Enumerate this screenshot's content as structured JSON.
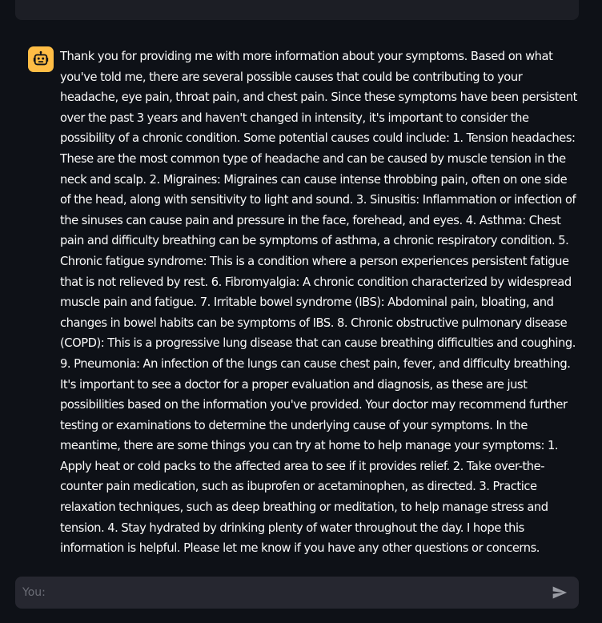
{
  "assistant_message": {
    "text": "Thank you for providing me with more information about your symptoms. Based on what you've told me, there are several possible causes that could be contributing to your headache, eye pain, throat pain, and chest pain. Since these symptoms have been persistent over the past 3 years and haven't changed in intensity, it's important to consider the possibility of a chronic condition. Some potential causes could include: 1. Tension headaches: These are the most common type of headache and can be caused by muscle tension in the neck and scalp. 2. Migraines: Migraines can cause intense throbbing pain, often on one side of the head, along with sensitivity to light and sound. 3. Sinusitis: Inflammation or infection of the sinuses can cause pain and pressure in the face, forehead, and eyes. 4. Asthma: Chest pain and difficulty breathing can be symptoms of asthma, a chronic respiratory condition. 5. Chronic fatigue syndrome: This is a condition where a person experiences persistent fatigue that is not relieved by rest. 6. Fibromyalgia: A chronic condition characterized by widespread muscle pain and fatigue. 7. Irritable bowel syndrome (IBS): Abdominal pain, bloating, and changes in bowel habits can be symptoms of IBS. 8. Chronic obstructive pulmonary disease (COPD): This is a progressive lung disease that can cause breathing difficulties and coughing. 9. Pneumonia: An infection of the lungs can cause chest pain, fever, and difficulty breathing. It's important to see a doctor for a proper evaluation and diagnosis, as these are just possibilities based on the information you've provided. Your doctor may recommend further testing or examinations to determine the underlying cause of your symptoms. In the meantime, there are some things you can try at home to help manage your symptoms: 1. Apply heat or cold packs to the affected area to see if it provides relief. 2. Take over-the-counter pain medication, such as ibuprofen or acetaminophen, as directed. 3. Practice relaxation techniques, such as deep breathing or meditation, to help manage stress and tension. 4. Stay hydrated by drinking plenty of water throughout the day. I hope this information is helpful. Please let me know if you have any other questions or concerns.",
    "avatar_icon": "robot-icon",
    "avatar_color": "#ffbd45"
  },
  "chat_input": {
    "placeholder": "You:",
    "value": "",
    "send_icon": "send-icon"
  }
}
